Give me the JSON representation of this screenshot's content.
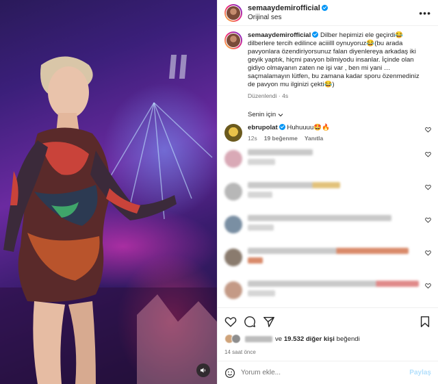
{
  "header": {
    "username": "semaaydemirofficial",
    "audio": "Orijinal ses",
    "more_icon": "more-horizontal-icon"
  },
  "caption": {
    "username": "semaaydemirofficial",
    "text": "Dilber hepimizi ele geçirdi😂dilberlere tercih edilince aciiilll oynuyoruz😂(bu arada pavyonlara özendiriyorsunuz falan diyenlereya arkadaş iki geyik yaptık, hiçmi pavyon bilmiyodu insanlar. İçinde olan gidiyo olmayanın zaten ne işi var , ben mi yani …saçmalamayın lütfen, bu zamana kadar sporu özenmediniz de pavyon mu ilginizi çekti😂)",
    "edited": "Düzenlendi",
    "time": "4s"
  },
  "filter": {
    "label": "Senin için",
    "icon": "chevron-down-icon"
  },
  "comments": [
    {
      "username": "ebrupolat",
      "text": "Huhuuuu🤩🔥",
      "time": "12s",
      "likes": "19 beğenme",
      "reply": "Yanıtla"
    }
  ],
  "actions": {
    "like_icon": "heart-icon",
    "comment_icon": "comment-icon",
    "share_icon": "share-icon",
    "save_icon": "bookmark-icon"
  },
  "likes": {
    "connector": "ve",
    "count_text": "19.532 diğer kişi",
    "suffix": "beğendi"
  },
  "posted_time": "14 saat önce",
  "add_comment": {
    "placeholder": "Yorum ekle...",
    "post_label": "Paylaş",
    "emoji_icon": "smiley-icon"
  },
  "media": {
    "mute_icon": "speaker-icon"
  },
  "colors": {
    "verified": "#0095f6",
    "link_disabled": "#b2dffc",
    "secondary_text": "#737373"
  }
}
